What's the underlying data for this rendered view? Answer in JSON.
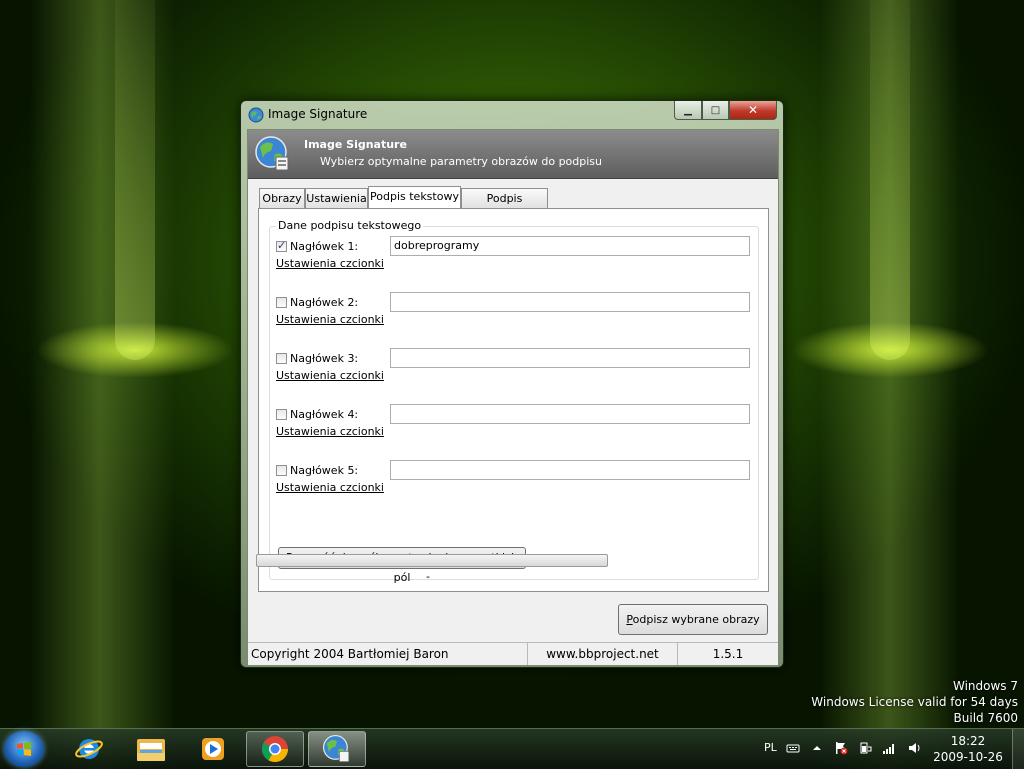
{
  "window": {
    "title": "Image Signature",
    "min_glyph": "▁",
    "max_glyph": "□",
    "close_glyph": "✕"
  },
  "header": {
    "title": "Image Signature",
    "subtitle": "Wybierz optymalne parametry obrazów do podpisu"
  },
  "tabs": [
    {
      "label": "Obrazy",
      "active": false
    },
    {
      "label": "Ustawienia",
      "active": false
    },
    {
      "label": "Podpis tekstowy",
      "active": true
    },
    {
      "label": "Podpis graficzny",
      "active": false
    }
  ],
  "group": {
    "legend": "Dane podpisu tekstowego",
    "font_link": "Ustawienia czcionki",
    "rows": [
      {
        "label": "Nagłówek 1:",
        "checked": true,
        "value": "dobreprogramy"
      },
      {
        "label": "Nagłówek 2:",
        "checked": false,
        "value": ""
      },
      {
        "label": "Nagłówek 3:",
        "checked": false,
        "value": ""
      },
      {
        "label": "Nagłówek 4:",
        "checked": false,
        "value": ""
      },
      {
        "label": "Nagłówek 5:",
        "checked": false,
        "value": ""
      }
    ],
    "reset_button": "Przywróć domyślne ustawienia wszystkich pól"
  },
  "progress": {
    "value": 0,
    "text": "-"
  },
  "sign_button": {
    "accel": "P",
    "rest": "odpisz wybrane obrazy"
  },
  "statusbar": {
    "copyright": "Copyright 2004 Bartłomiej Baron",
    "website": "www.bbproject.net",
    "version": "1.5.1"
  },
  "desktop_watermark": {
    "line1": "Windows 7",
    "line2": "Windows License valid for 54 days",
    "line3": "Build 7600"
  },
  "taskbar": {
    "language": "PL",
    "time": "18:22",
    "date": "2009-10-26"
  }
}
